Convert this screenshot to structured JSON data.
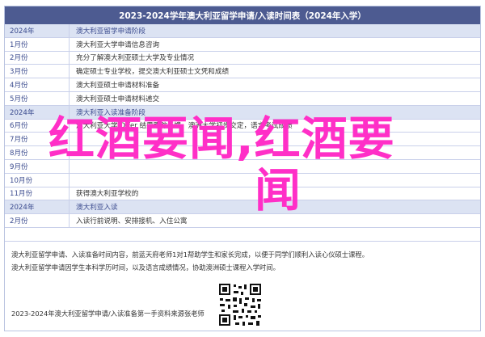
{
  "title": "2023-2024学年澳大利亚留学申请/入读时间表（2024年入学）",
  "rows": [
    {
      "month": "2024年",
      "text": "澳大利亚留学申请阶段",
      "section": true
    },
    {
      "month": "1月份",
      "text": "澳大利亚大学申请信息咨询",
      "section": false
    },
    {
      "month": "2月份",
      "text": "充分了解澳大利亚硕士大学及专业情况",
      "section": false
    },
    {
      "month": "3月份",
      "text": "确定硕士专业学校，提交澳大利亚硕士文凭和成绩",
      "section": false
    },
    {
      "month": "4月份",
      "text": "澳大利亚硕士申请材料准备",
      "section": false
    },
    {
      "month": "5月份",
      "text": "澳大利亚硕士申请材料递交",
      "section": false
    },
    {
      "month": "2024年",
      "text": "澳大利亚入读准备阶段",
      "section": true
    },
    {
      "month": "6月份",
      "text": "澳大利亚大学 Offer 结果跟踪反馈，澳洲大学初步交定，语言考试成绩",
      "section": false
    },
    {
      "month": "7月份",
      "text": "",
      "section": false
    },
    {
      "month": "8月份",
      "text": "",
      "section": false
    },
    {
      "month": "9月份",
      "text": "",
      "section": false
    },
    {
      "month": "10月份",
      "text": "",
      "section": false
    },
    {
      "month": "11月份",
      "text": "获得澳大利亚学校的",
      "section": false
    },
    {
      "month": "2024年",
      "text": "澳大利亚入读",
      "section": true
    },
    {
      "month": "2月份",
      "text": "入读行前说明、安排接机、入住公寓",
      "section": false
    }
  ],
  "footer": {
    "line1": "澳大利亚留学申请、入读准备时间内容，前蓝天府老师1对1帮助学生和家长完成，以便于同学们顺利入读心仪硕士课程。",
    "line2": "澳大利亚留学申请因学生本科学历时间，以及语言成绩情况，协助澳洲硕士课程入学时间。",
    "line3": "2023-2024年澳大利亚留学申请/入读准备第一手资料来源张老师"
  },
  "overlay": {
    "line1": "红酒要闻,红酒要",
    "line2": "闻"
  },
  "colors": {
    "header": "#4d5b91",
    "section": "#dce3f3",
    "overlay": "#ff2fc7"
  }
}
